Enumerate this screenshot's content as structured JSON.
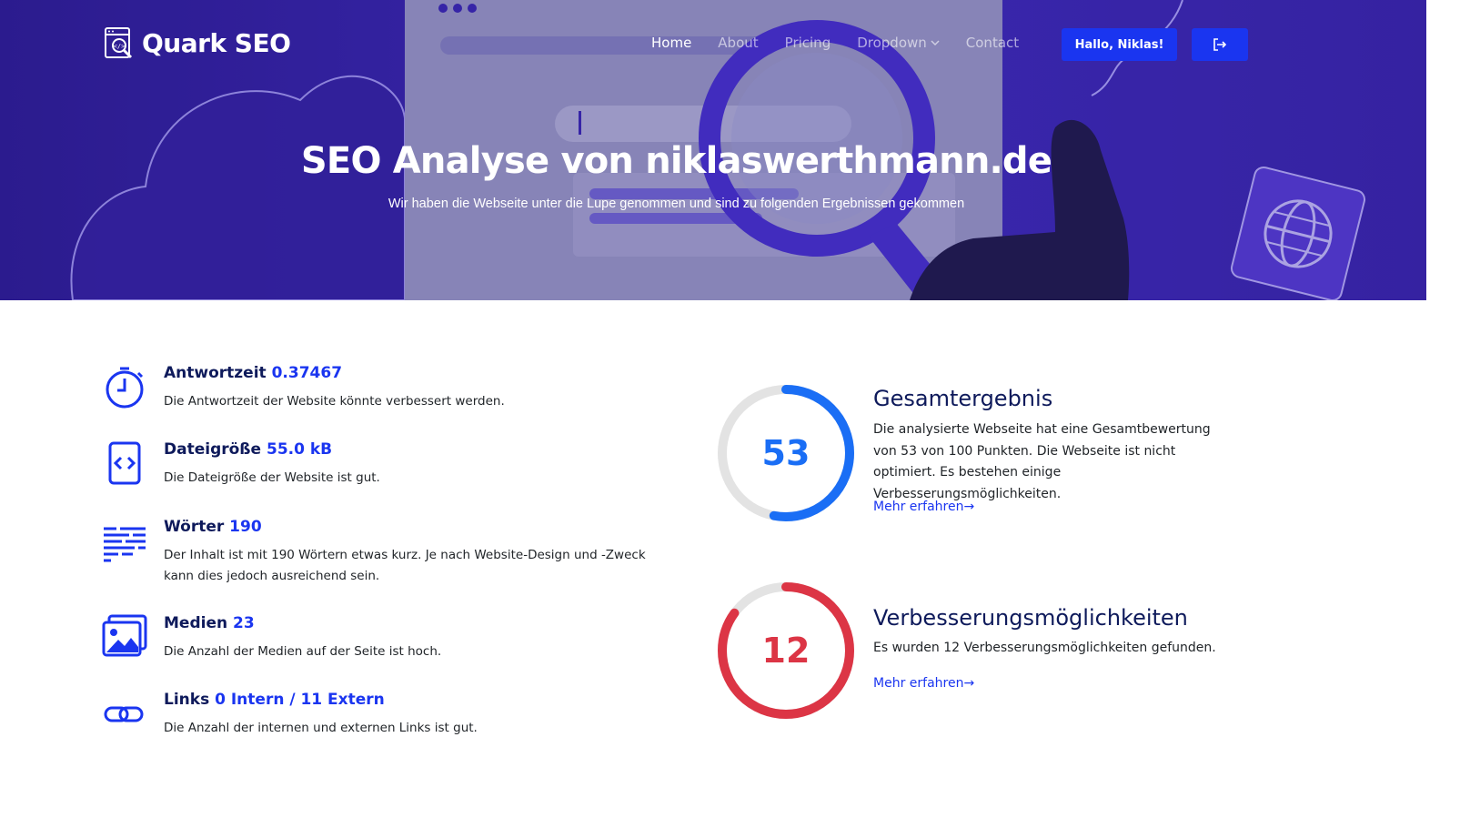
{
  "brand": {
    "name": "Quark SEO",
    "logo_icon": "seo-code-search-icon"
  },
  "nav": {
    "items": [
      {
        "label": "Home",
        "active": true
      },
      {
        "label": "About",
        "active": false
      },
      {
        "label": "Pricing",
        "active": false
      },
      {
        "label": "Dropdown",
        "active": false,
        "has_caret": true
      },
      {
        "label": "Contact",
        "active": false
      }
    ],
    "user_button": "Hallo, Niklas!",
    "logout_icon": "logout-icon"
  },
  "hero": {
    "title": "SEO Analyse von niklaswerthmann.de",
    "subtitle": "Wir haben die Webseite unter die Lupe genommen und sind zu folgenden Ergebnissen gekommen"
  },
  "metrics": [
    {
      "icon": "stopwatch-icon",
      "label": "Antwortzeit",
      "value": "0.37467",
      "description": "Die Antwortzeit der Website könnte verbessert werden."
    },
    {
      "icon": "code-file-icon",
      "label": "Dateigröße",
      "value": "55.0 kB",
      "description": "Die Dateigröße der Website ist gut."
    },
    {
      "icon": "text-lines-icon",
      "label": "Wörter",
      "value": "190",
      "description": "Der Inhalt ist mit 190 Wörtern etwas kurz. Je nach Website-Design und -Zweck kann dies jedoch ausreichend sein."
    },
    {
      "icon": "images-icon",
      "label": "Medien",
      "value": "23",
      "description": "Die Anzahl der Medien auf der Seite ist hoch."
    },
    {
      "icon": "link-icon",
      "label": "Links",
      "value": "0 Intern / 11 Extern",
      "description": "Die Anzahl der internen und externen Links ist gut."
    }
  ],
  "scores": [
    {
      "value": "53",
      "max": 100,
      "progress": 0.53,
      "color": "#1a6ef5",
      "title": "Gesamtergebnis",
      "text": "Die analysierte Webseite hat eine Gesamtbewertung von 53 von 100 Punkten. Die Webseite ist nicht optimiert. Es bestehen einige Verbesserungsmöglichkeiten.",
      "link": "Mehr erfahren→"
    },
    {
      "value": "12",
      "progress": 0.85,
      "color": "#dc3545",
      "title": "Verbesserungsmöglichkeiten",
      "text": "Es wurden 12 Verbesserungsmöglichkeiten gefunden.",
      "link": "Mehr erfahren→"
    }
  ],
  "colors": {
    "primary": "#1a35f0",
    "heading": "#0e1a5b",
    "hero": "#3b28b0",
    "ring_track": "#e3e3e3"
  }
}
